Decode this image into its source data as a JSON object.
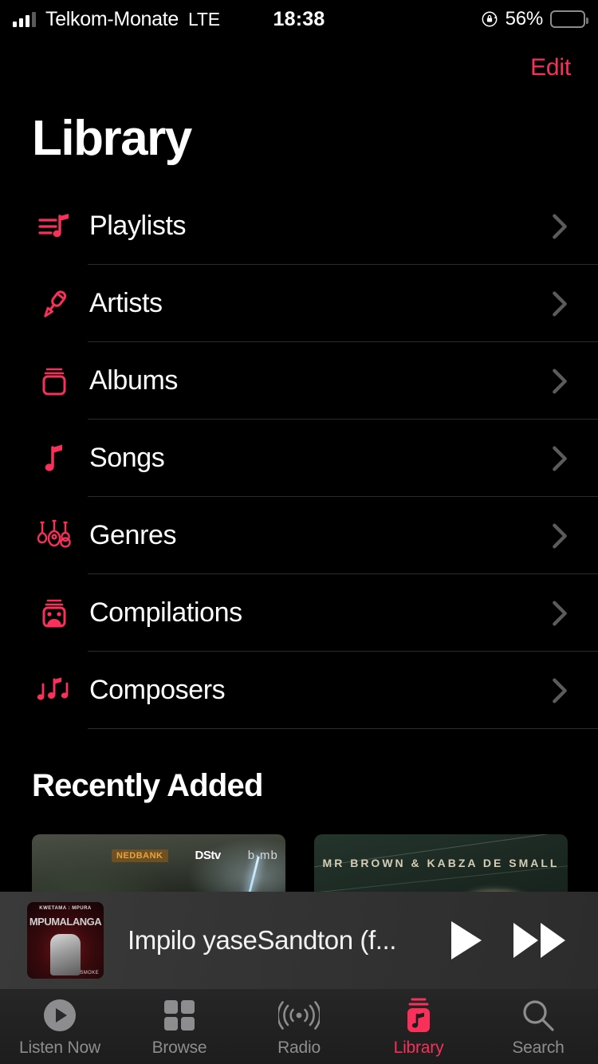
{
  "status_bar": {
    "carrier": "Telkom-Monate",
    "network": "LTE",
    "time": "18:38",
    "battery_percent": "56%",
    "battery_level": 56,
    "battery_color": "#fdd014",
    "rotation_lock_icon": "rotation-lock-icon",
    "signal_icon": "signal-bars-icon"
  },
  "nav": {
    "edit_label": "Edit",
    "title": "Library"
  },
  "theme": {
    "accent": "#f8305a",
    "background": "#000000",
    "separator": "#2b2b2d",
    "inactive_tab": "#8d8d8f"
  },
  "library_items": [
    {
      "label": "Playlists",
      "icon": "playlist-note-icon",
      "chevron": "chevron-right-icon"
    },
    {
      "label": "Artists",
      "icon": "microphone-icon",
      "chevron": "chevron-right-icon"
    },
    {
      "label": "Albums",
      "icon": "album-stack-icon",
      "chevron": "chevron-right-icon"
    },
    {
      "label": "Songs",
      "icon": "music-note-icon",
      "chevron": "chevron-right-icon"
    },
    {
      "label": "Genres",
      "icon": "guitars-icon",
      "chevron": "chevron-right-icon"
    },
    {
      "label": "Compilations",
      "icon": "compilation-icon",
      "chevron": "chevron-right-icon"
    },
    {
      "label": "Composers",
      "icon": "triple-note-icon",
      "chevron": "chevron-right-icon"
    }
  ],
  "recently_added": {
    "heading": "Recently Added",
    "albums": [
      {
        "artwork_name": "storm-lightning-artwork",
        "logo_primary": "NEDBANK",
        "logo_secondary": "DStv",
        "logo_tertiary": "b·mb"
      },
      {
        "artwork_name": "mr-brown-kabza-artwork",
        "artist_text": "MR BROWN & KABZA DE SMALL"
      }
    ]
  },
  "mini_player": {
    "track_title": "Impilo yaseSandton (f...",
    "artwork_top_text": "KWETAMA : MPURA",
    "artwork_title": "MPUMALANGA",
    "artwork_footer": "SMOKE",
    "play_icon": "play-icon",
    "next_icon": "fast-forward-icon"
  },
  "tab_bar": {
    "active_index": 3,
    "tabs": [
      {
        "label": "Listen Now",
        "icon": "play-circle-icon"
      },
      {
        "label": "Browse",
        "icon": "grid-squares-icon"
      },
      {
        "label": "Radio",
        "icon": "radio-waves-icon"
      },
      {
        "label": "Library",
        "icon": "library-icon"
      },
      {
        "label": "Search",
        "icon": "search-icon"
      }
    ]
  }
}
